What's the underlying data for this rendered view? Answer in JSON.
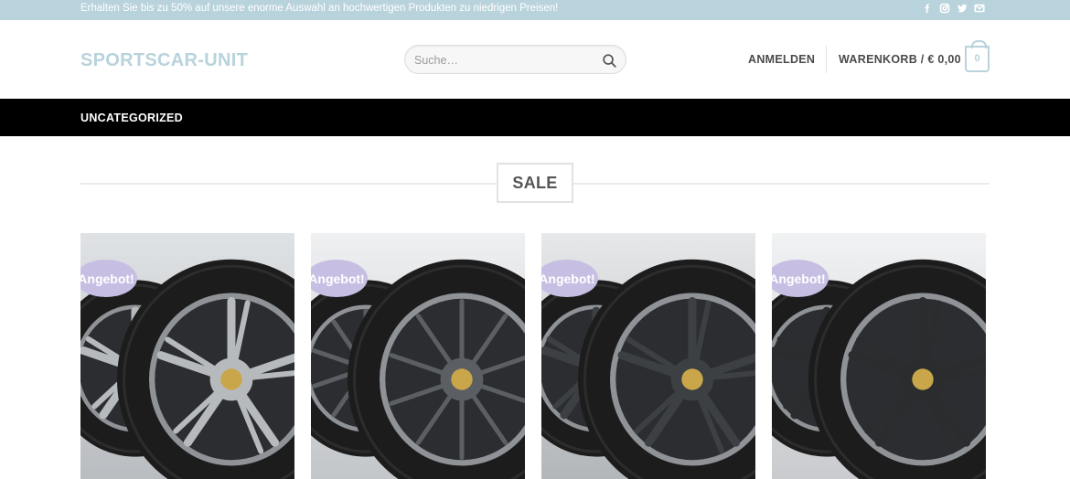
{
  "topbar": {
    "promo_text": "Erhalten Sie bis zu 50% auf unsere enorme Auswahl an hochwertigen Produkten zu niedrigen Preisen!",
    "social_icons": [
      "facebook-icon",
      "instagram-icon",
      "twitter-icon",
      "mail-icon"
    ]
  },
  "header": {
    "logo": "SPORTSCAR-UNIT",
    "search_placeholder": "Suche…",
    "login_label": "ANMELDEN",
    "cart_label": "WARENKORB / € 0,00",
    "cart_count": "0"
  },
  "nav": {
    "items": [
      {
        "label": "UNCATEGORIZED"
      }
    ]
  },
  "section": {
    "title": "SALE"
  },
  "products": [
    {
      "badge": "Angebot!",
      "rim_color": "#b7babd",
      "bg_top": "#dfe2e5",
      "bg_bottom": "#b9bcc0",
      "spokes": 5
    },
    {
      "badge": "Angebot!",
      "rim_color": "#5b5f63",
      "bg_top": "#eef0f2",
      "bg_bottom": "#c3c6c9",
      "spokes": 10
    },
    {
      "badge": "Angebot!",
      "rim_color": "#3d4043",
      "bg_top": "#e6e8ea",
      "bg_bottom": "#b3b6b9",
      "spokes": 5
    },
    {
      "badge": "Angebot!",
      "rim_color": "#2a2c2e",
      "bg_top": "#f1f2f3",
      "bg_bottom": "#c9cbce",
      "spokes": 5
    }
  ],
  "colors": {
    "accent": "#b9d3dc",
    "badge": "#c7bfe3",
    "nav_bg": "#000000"
  }
}
